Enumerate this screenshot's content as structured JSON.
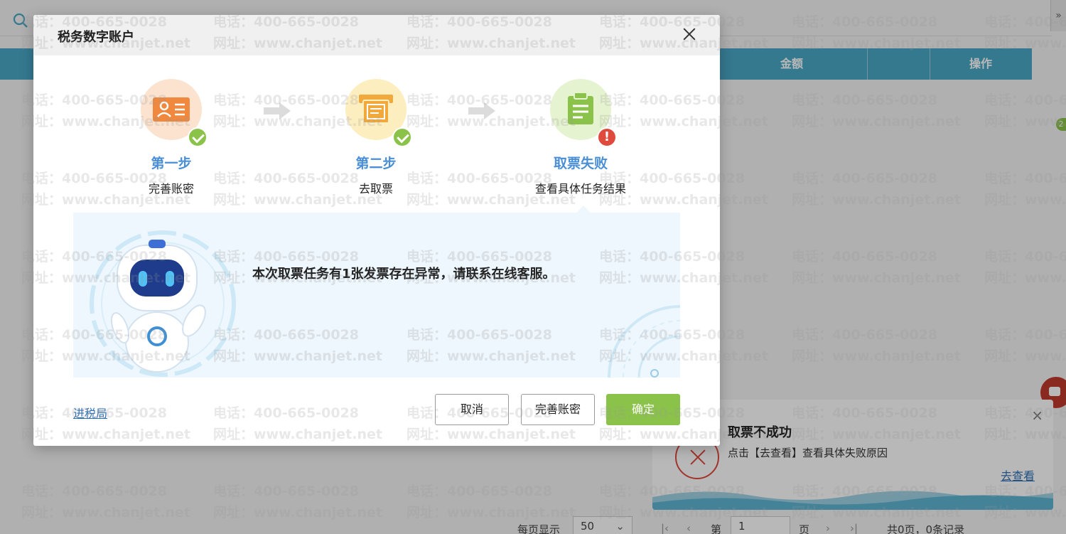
{
  "background": {
    "table_headers": [
      "金额",
      "操作"
    ],
    "pager": {
      "per_page_label": "每页显示",
      "per_page_value": "50",
      "page_prefix": "第",
      "page_value": "1",
      "page_suffix": "页",
      "summary": "共0页，0条记录"
    },
    "badge": "2"
  },
  "toast": {
    "title": "取票不成功",
    "description": "点击【去查看】查看具体失败原因",
    "link": "去查看",
    "close": "×"
  },
  "dialog": {
    "title": "税务数字账户",
    "steps": [
      {
        "title": "第一步",
        "desc": "完善账密",
        "status": "success"
      },
      {
        "title": "第二步",
        "desc": "去取票",
        "status": "success"
      },
      {
        "title": "取票失败",
        "desc": "查看具体任务结果",
        "status": "error"
      }
    ],
    "error_mark": "!",
    "message": "本次取票任务有1张发票存在异常，请联系在线客服。",
    "link_bureau": "进税局",
    "buttons": {
      "cancel": "取消",
      "complete_account": "完善账密",
      "confirm": "确定"
    }
  },
  "watermark": {
    "phone": "电话：400-665-0028",
    "site": "网址：www.chanjet.net"
  },
  "colors": {
    "accent_green": "#8bc34a",
    "step_title_blue": "#4a8fd6",
    "table_header": "#4aa8c6",
    "error_red": "#e04a3d",
    "link_blue": "#2f6fb5"
  }
}
